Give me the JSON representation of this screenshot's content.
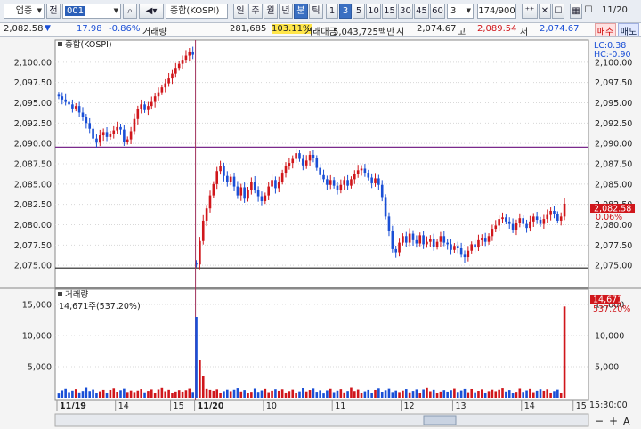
{
  "toolbar": {
    "category": "업종",
    "category_button": "전",
    "code": "001",
    "name": "종합(KOSPI)",
    "periods": [
      "일",
      "주",
      "월",
      "년",
      "분",
      "틱"
    ],
    "minutes": [
      "1",
      "3",
      "5",
      "10",
      "15",
      "30",
      "45",
      "60"
    ],
    "active_period": "분",
    "active_minute": "3",
    "interval_value": "3",
    "count": "174/900",
    "date": "11/20"
  },
  "infobar": {
    "price": "2,082.58",
    "change": "17.98",
    "change_pct": "-0.86%",
    "volume_label": "거래량",
    "volume": "281,685",
    "volume_pct": "103.11%",
    "amount_label": "거래대금",
    "amount": "5,043,725백만",
    "open_label": "시",
    "open": "2,074.67",
    "high_label": "고",
    "high": "2,089.54",
    "low_label": "저",
    "low": "2,074.67",
    "buy_label": "매수",
    "sell_label": "매도"
  },
  "colors": {
    "up": "#d0161b",
    "down": "#1a4fd6",
    "hline_high": "#7a2a8c",
    "hline_low": "#222222",
    "vline": "#a0305a"
  },
  "price_pane": {
    "title": "종합(KOSPI)",
    "lc": "LC:0.38",
    "hc": "HC:-0.90",
    "current_label": "2,082.58",
    "current_pct": "0.06%"
  },
  "volume_pane": {
    "title": "거래량",
    "legend": "14,671주(537.20%)",
    "current_label": "14,671",
    "current_pct": "537.20%"
  },
  "footer": {
    "time": "15:30:00",
    "zoom_minus": "−",
    "zoom_plus": "+",
    "auto": "A"
  },
  "chart_data": [
    {
      "type": "candlestick",
      "title": "종합(KOSPI)",
      "ylim": [
        2072.5,
        2102.5
      ],
      "y_ticks": [
        2075,
        2077.5,
        2080,
        2082.5,
        2085,
        2087.5,
        2090,
        2092.5,
        2095,
        2097.5,
        2100
      ],
      "y_tick_labels": [
        "2,075.00",
        "2,077.50",
        "2,080.00",
        "2,082.50",
        "2,085.00",
        "2,087.50",
        "2,090.00",
        "2,092.50",
        "2,095.00",
        "2,097.50",
        "2,100.00"
      ],
      "x_labels": [
        "11/19",
        "14",
        "15",
        "11/20",
        "10",
        "11",
        "12",
        "13",
        "14",
        "15"
      ],
      "h_lines": [
        2089.54,
        2074.67
      ],
      "close_path": [
        2095.8,
        2095.4,
        2095.1,
        2094.8,
        2094.3,
        2094.6,
        2093.8,
        2093.2,
        2092.5,
        2091.8,
        2090.6,
        2090.1,
        2091.0,
        2091.4,
        2090.8,
        2091.2,
        2091.6,
        2092.0,
        2091.7,
        2090.2,
        2090.5,
        2091.5,
        2093.0,
        2094.2,
        2094.8,
        2094.1,
        2094.6,
        2095.1,
        2095.8,
        2096.3,
        2096.9,
        2097.4,
        2098.0,
        2098.6,
        2099.3,
        2099.8,
        2100.3,
        2100.8,
        2101.3,
        2100.9,
        2075.1,
        2078.0,
        2080.5,
        2082.0,
        2083.6,
        2085.0,
        2086.6,
        2087.2,
        2086.0,
        2085.2,
        2085.9,
        2084.7,
        2083.6,
        2084.6,
        2083.2,
        2084.3,
        2085.3,
        2084.3,
        2083.5,
        2082.9,
        2083.6,
        2084.7,
        2085.5,
        2084.5,
        2085.3,
        2086.4,
        2087.2,
        2087.6,
        2088.1,
        2088.8,
        2088.1,
        2087.3,
        2087.9,
        2088.6,
        2088.2,
        2087.0,
        2086.1,
        2085.6,
        2084.9,
        2085.5,
        2084.8,
        2084.3,
        2084.9,
        2085.5,
        2084.8,
        2085.6,
        2086.2,
        2086.7,
        2086.9,
        2086.4,
        2085.8,
        2085.1,
        2085.7,
        2084.9,
        2083.4,
        2081.0,
        2079.2,
        2077.0,
        2076.6,
        2077.8,
        2078.6,
        2077.8,
        2078.9,
        2078.1,
        2077.7,
        2078.7,
        2077.6,
        2077.9,
        2078.3,
        2077.3,
        2077.9,
        2078.6,
        2077.8,
        2077.6,
        2076.9,
        2077.4,
        2077.1,
        2076.4,
        2076.0,
        2076.8,
        2077.6,
        2077.2,
        2078.1,
        2078.4,
        2077.9,
        2078.6,
        2079.5,
        2079.9,
        2080.7,
        2080.9,
        2080.4,
        2080.1,
        2079.4,
        2080.2,
        2080.8,
        2080.1,
        2079.6,
        2080.4,
        2081.0,
        2080.6,
        2080.1,
        2080.7,
        2081.2,
        2081.7,
        2081.3,
        2080.5,
        2081.0,
        2082.58
      ]
    },
    {
      "type": "bar",
      "title": "거래량",
      "ylim": [
        0,
        17000
      ],
      "y_ticks": [
        5000,
        10000,
        15000
      ],
      "y_tick_labels": [
        "5,000",
        "10,000",
        "15,000"
      ],
      "values_note": "bars: one per candle",
      "spike_values": [
        13000,
        6000,
        3500
      ],
      "last_value": 14671
    }
  ]
}
